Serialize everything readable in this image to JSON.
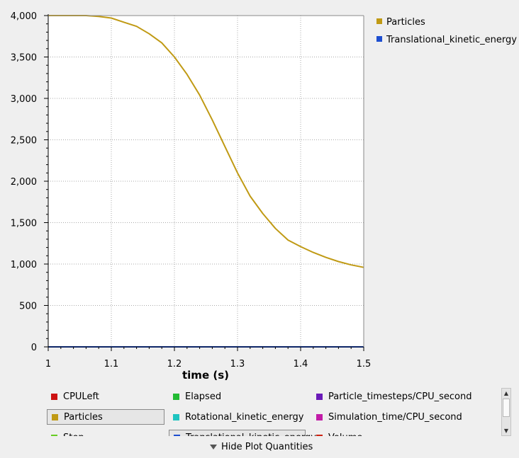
{
  "chart_data": {
    "type": "line",
    "title": "",
    "xlabel": "time (s)",
    "ylabel": "",
    "xlim": [
      1,
      1.5
    ],
    "ylim": [
      0,
      4000
    ],
    "x_ticks": [
      1,
      1.1,
      1.2,
      1.3,
      1.4,
      1.5
    ],
    "x_tick_labels": [
      "1",
      "1.1",
      "1.2",
      "1.3",
      "1.4",
      "1.5"
    ],
    "y_ticks": [
      0,
      500,
      1000,
      1500,
      2000,
      2500,
      3000,
      3500,
      4000
    ],
    "y_tick_labels": [
      "0",
      "500",
      "1,000",
      "1,500",
      "2,000",
      "2,500",
      "3,000",
      "3,500",
      "4,000"
    ],
    "grid": true,
    "legend_position": "top-right",
    "series": [
      {
        "name": "Particles",
        "color": "#c09a14",
        "x": [
          1.0,
          1.02,
          1.04,
          1.06,
          1.08,
          1.1,
          1.12,
          1.14,
          1.16,
          1.18,
          1.2,
          1.22,
          1.24,
          1.26,
          1.28,
          1.3,
          1.32,
          1.34,
          1.36,
          1.38,
          1.4,
          1.42,
          1.44,
          1.46,
          1.48,
          1.5
        ],
        "y": [
          4000,
          4000,
          4000,
          4000,
          3990,
          3970,
          3920,
          3870,
          3780,
          3670,
          3500,
          3290,
          3040,
          2740,
          2420,
          2100,
          1820,
          1610,
          1430,
          1290,
          1210,
          1140,
          1080,
          1030,
          990,
          960
        ]
      },
      {
        "name": "Translational_kinetic_energy",
        "color": "#1d4ed0",
        "x": [
          1.0,
          1.5
        ],
        "y": [
          0,
          0
        ]
      }
    ]
  },
  "plot_quantities": {
    "items": [
      {
        "label": "CPULeft",
        "color": "#cc1111",
        "selected": false
      },
      {
        "label": "Elapsed",
        "color": "#22bb33",
        "selected": false
      },
      {
        "label": "Particle_timesteps/CPU_second",
        "color": "#6a1ab8",
        "selected": false
      },
      {
        "label": "Particles",
        "color": "#c09a14",
        "selected": true
      },
      {
        "label": "Rotational_kinetic_energy",
        "color": "#1ec4c0",
        "selected": false
      },
      {
        "label": "Simulation_time/CPU_second",
        "color": "#c21ca8",
        "selected": false
      },
      {
        "label": "Step",
        "color": "#66cc22",
        "selected": false
      },
      {
        "label": "Translational_kinetic_energy",
        "color": "#1d4ed0",
        "selected": true
      },
      {
        "label": "Volume",
        "color": "#cc2211",
        "selected": false
      }
    ],
    "toggle_label": "Hide Plot Quantities",
    "toggle_icon": "triangle-down-icon"
  }
}
